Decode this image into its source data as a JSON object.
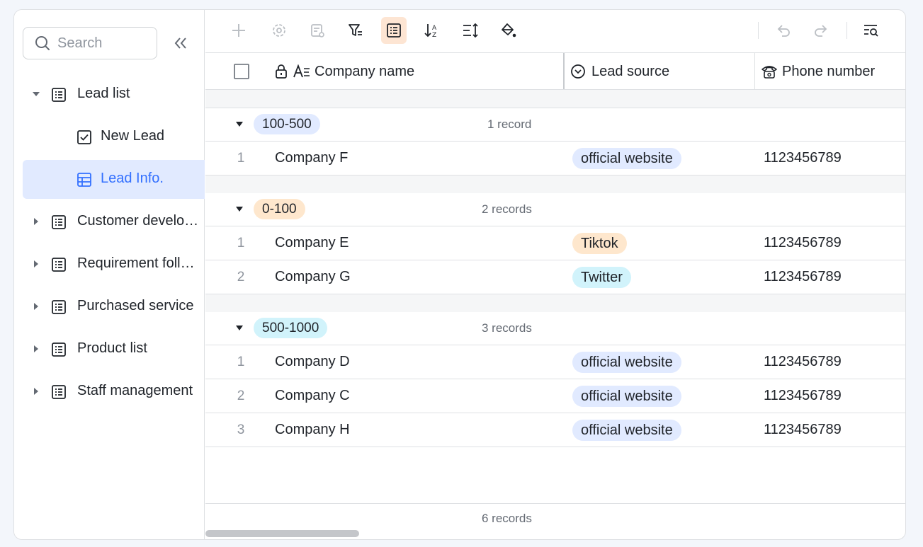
{
  "sidebar": {
    "search_placeholder": "Search",
    "items": [
      {
        "label": "Lead list",
        "icon": "table-icon",
        "expanded": true
      },
      {
        "label": "New Lead",
        "icon": "form-check-icon",
        "child": true
      },
      {
        "label": "Lead Info.",
        "icon": "grid-view-icon",
        "child": true,
        "active": true
      },
      {
        "label": "Customer develo…",
        "icon": "table-icon"
      },
      {
        "label": "Requirement foll…",
        "icon": "table-icon"
      },
      {
        "label": "Purchased service",
        "icon": "table-icon"
      },
      {
        "label": "Product list",
        "icon": "table-icon"
      },
      {
        "label": "Staff management",
        "icon": "table-icon"
      }
    ]
  },
  "table": {
    "columns": [
      {
        "label": "Company name",
        "icon": "text-field-icon"
      },
      {
        "label": "Lead source",
        "icon": "single-select-icon"
      },
      {
        "label": "Phone number",
        "icon": "phone-icon"
      }
    ],
    "groups": [
      {
        "label": "100-500",
        "count": "1 record",
        "color": "#e1eaff",
        "rows": [
          {
            "num": "1",
            "company": "Company F",
            "source": "official website",
            "source_color": "#e1eaff",
            "phone": "1123456789"
          }
        ]
      },
      {
        "label": "0-100",
        "count": "2 records",
        "color": "#fee7cd",
        "rows": [
          {
            "num": "1",
            "company": "Company E",
            "source": "Tiktok",
            "source_color": "#fee7cd",
            "phone": "1123456789"
          },
          {
            "num": "2",
            "company": "Company G",
            "source": "Twitter",
            "source_color": "#d1f3fb",
            "phone": "1123456789"
          }
        ]
      },
      {
        "label": "500-1000",
        "count": "3 records",
        "color": "#d1f3fb",
        "rows": [
          {
            "num": "1",
            "company": "Company D",
            "source": "official website",
            "source_color": "#e1eaff",
            "phone": "1123456789"
          },
          {
            "num": "2",
            "company": "Company C",
            "source": "official website",
            "source_color": "#e1eaff",
            "phone": "1123456789"
          },
          {
            "num": "3",
            "company": "Company H",
            "source": "official website",
            "source_color": "#e1eaff",
            "phone": "1123456789"
          }
        ]
      }
    ],
    "total": "6 records"
  },
  "colors": {
    "accent": "#3370ff",
    "active_tool": "#fde5d3"
  }
}
